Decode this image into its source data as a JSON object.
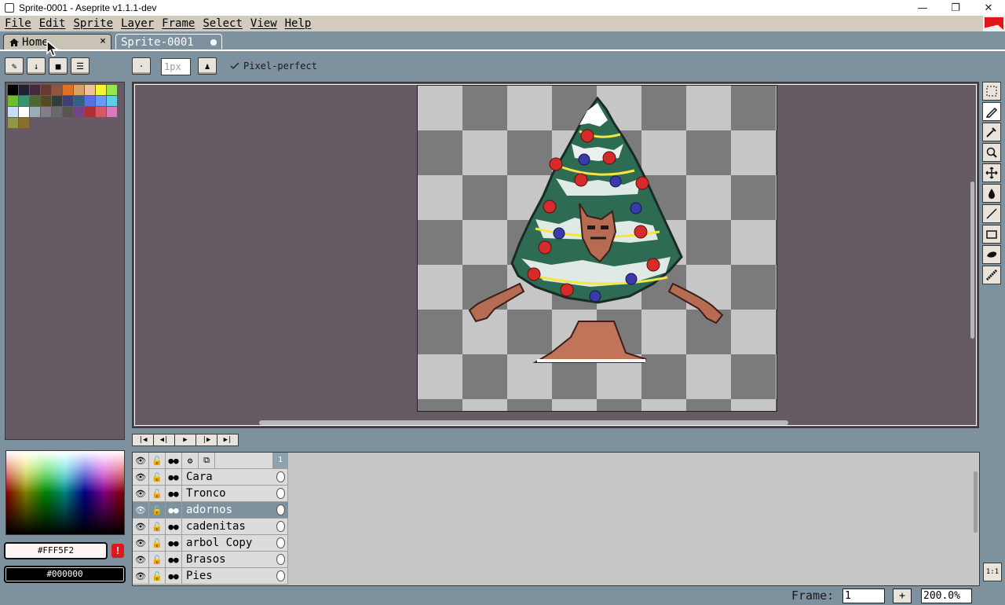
{
  "window": {
    "title": "Sprite-0001 - Aseprite v1.1.1-dev",
    "minimize": "—",
    "maximize": "❐",
    "close": "✕"
  },
  "menu": [
    "File",
    "Edit",
    "Sprite",
    "Layer",
    "Frame",
    "Select",
    "View",
    "Help"
  ],
  "tabs": {
    "home": "Home",
    "sprite": "Sprite-0001",
    "close_glyph": "×"
  },
  "context": {
    "brush_size": "1px",
    "pixel_perfect_label": "Pixel-perfect",
    "pixel_perfect_checked": true
  },
  "palette": [
    "#000000",
    "#222034",
    "#45283c",
    "#663931",
    "#8f563b",
    "#df7126",
    "#d9a066",
    "#eec39a",
    "#fbf236",
    "#99e550",
    "#6abe30",
    "#37946e",
    "#4b692f",
    "#524b24",
    "#323c39",
    "#3f3f74",
    "#306082",
    "#5b6ee1",
    "#639bff",
    "#5fcde4",
    "#cbdbfc",
    "#ffffff",
    "#9badb7",
    "#847e87",
    "#696a6a",
    "#595652",
    "#76428a",
    "#ac3232",
    "#d95763",
    "#d77bba",
    "#8f974a",
    "#8a6f30"
  ],
  "colors": {
    "foreground": "#FFF5F2",
    "background": "#000000",
    "warning": "!"
  },
  "timeline": {
    "frame_header": "1",
    "layers": [
      {
        "name": "Cara",
        "selected": false
      },
      {
        "name": "Tronco",
        "selected": false
      },
      {
        "name": "adornos",
        "selected": true
      },
      {
        "name": "cadenitas",
        "selected": false
      },
      {
        "name": "arbol Copy",
        "selected": false
      },
      {
        "name": "Brasos",
        "selected": false
      },
      {
        "name": "Pies",
        "selected": false
      }
    ]
  },
  "status": {
    "frame_label": "Frame:",
    "frame_value": "1",
    "add_glyph": "+",
    "zoom": "200.0%"
  }
}
